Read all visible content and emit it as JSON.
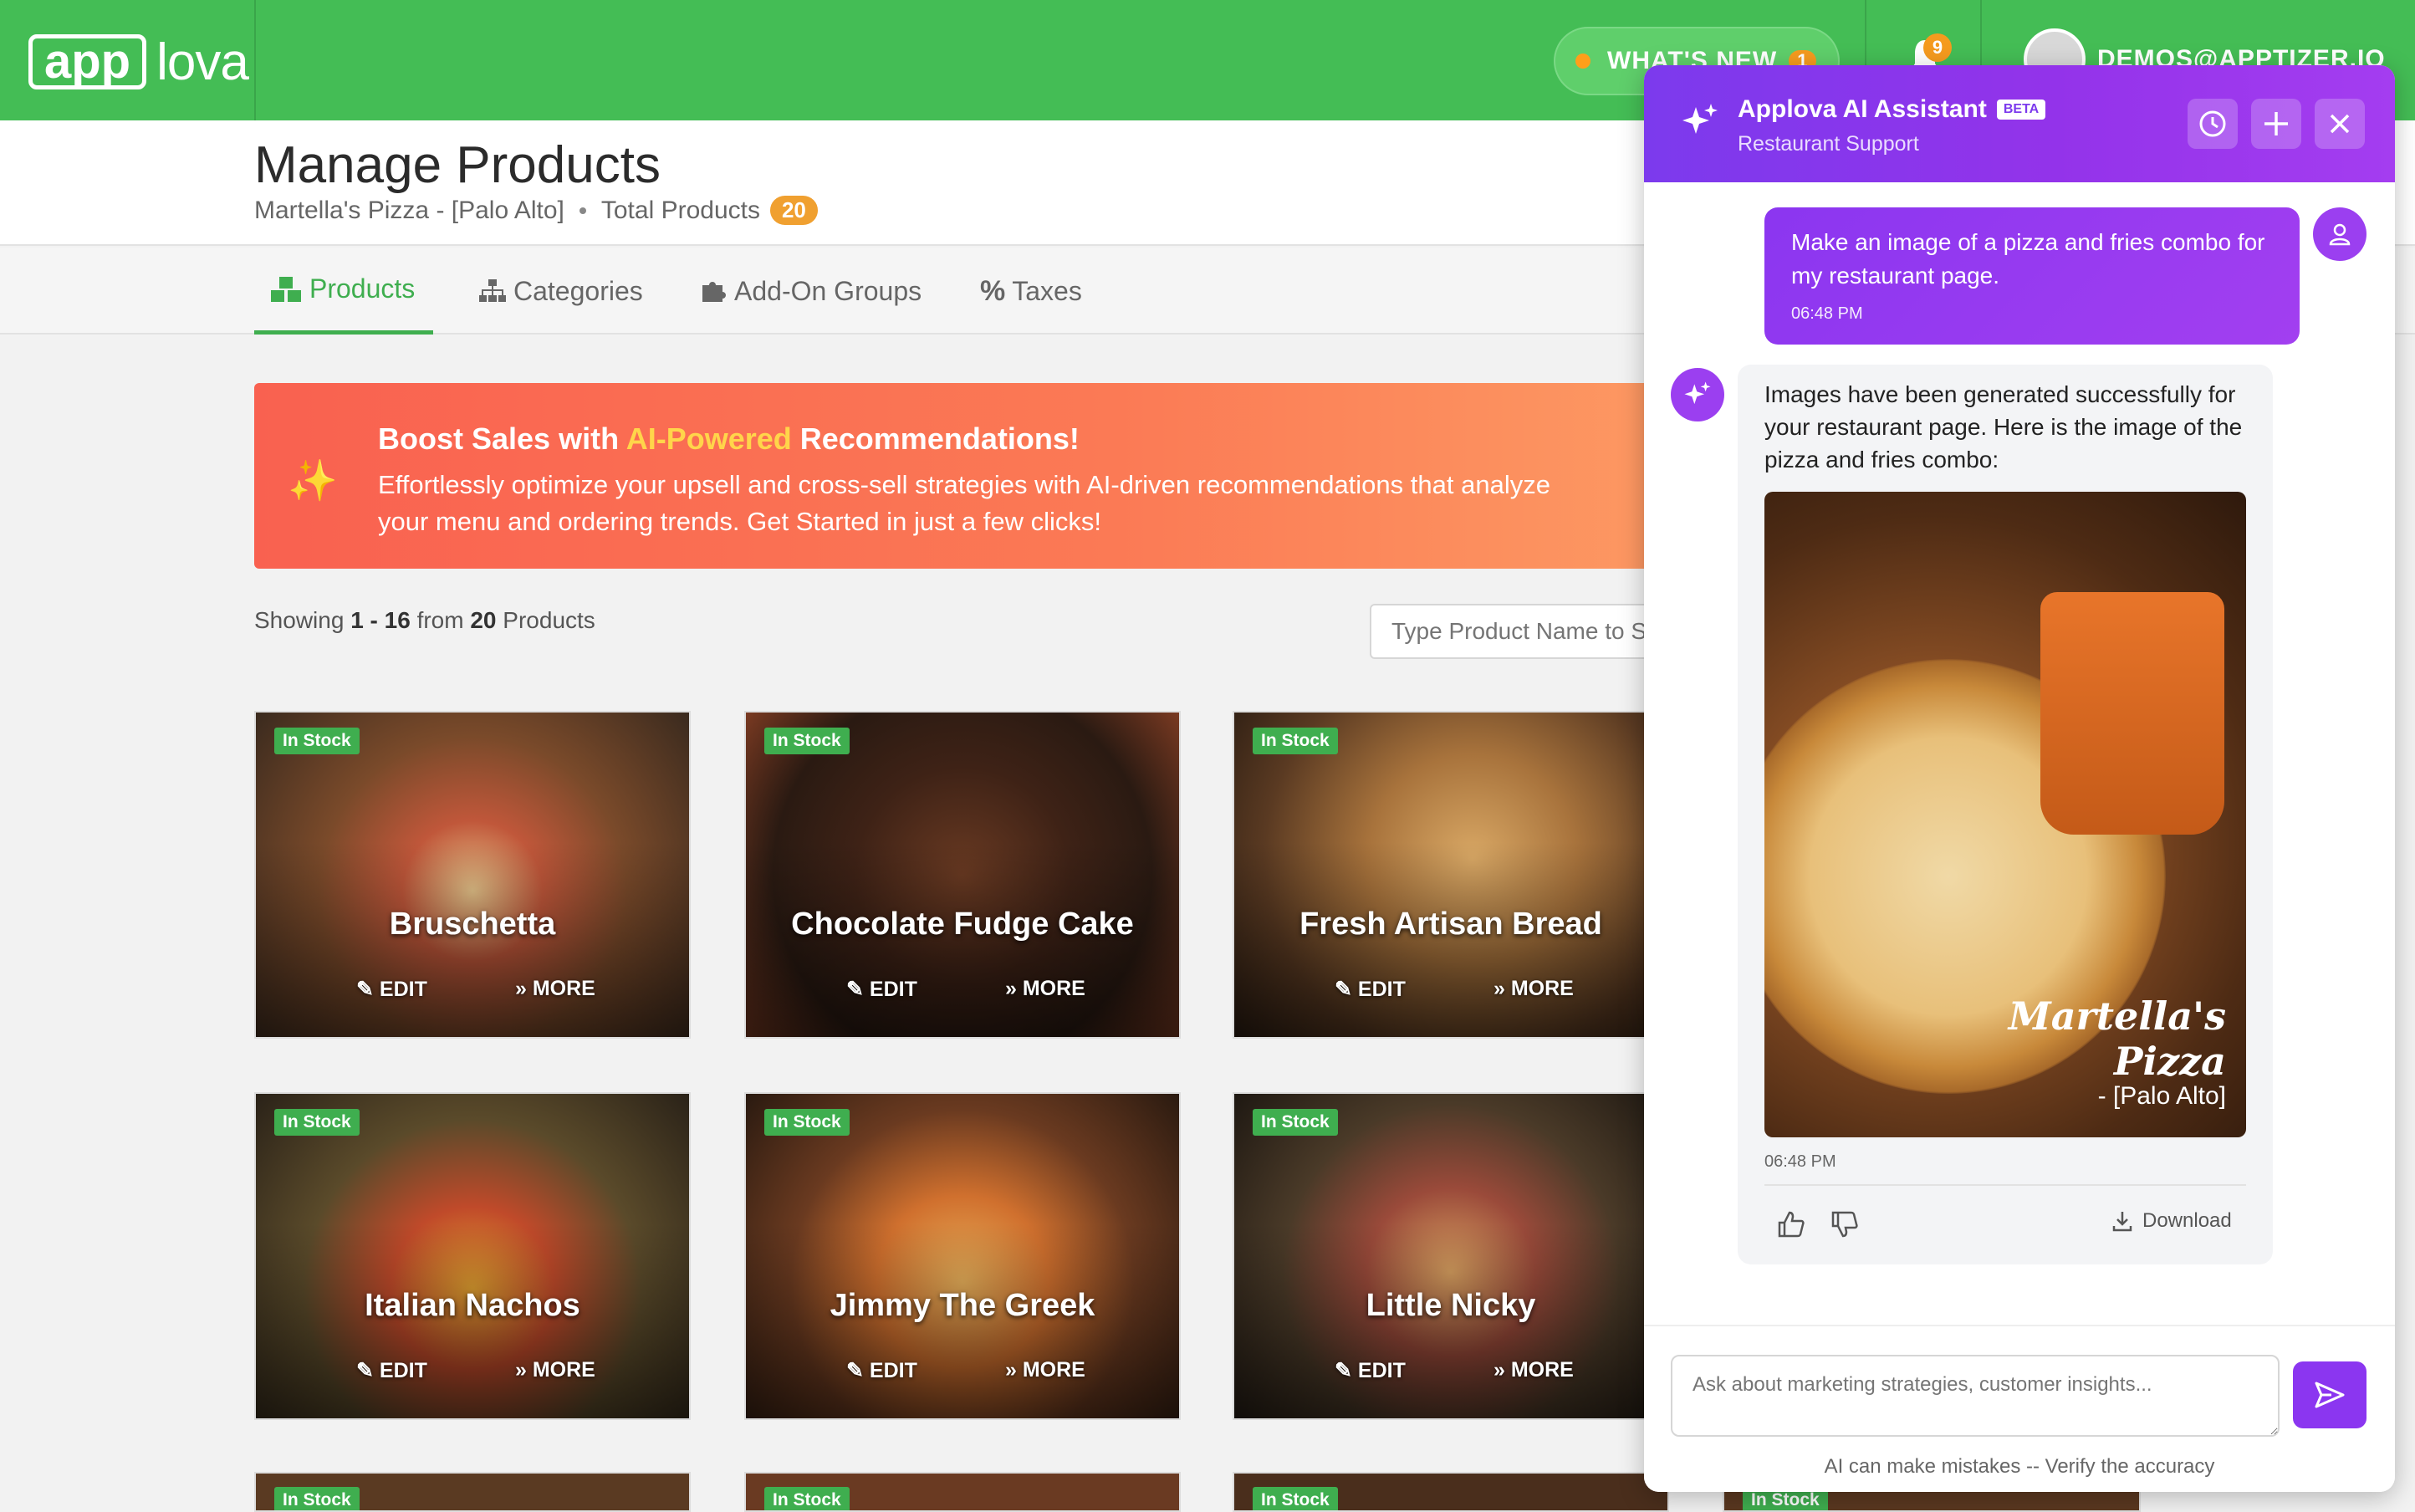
{
  "topbar": {
    "logo_box": "app",
    "logo_rest": "lova",
    "whats_new": "WHAT'S NEW",
    "whats_new_count": "1",
    "notification_count": "9",
    "user_email": "DEMOS@APPTIZER.IO"
  },
  "header": {
    "title": "Manage Products",
    "store": "Martella's Pizza - [Palo Alto]",
    "total_label": "Total Products",
    "total_count": "20"
  },
  "tabs": [
    {
      "label": "Products"
    },
    {
      "label": "Categories"
    },
    {
      "label": "Add-On Groups"
    },
    {
      "label": "Taxes"
    }
  ],
  "promo": {
    "title_pre": "Boost Sales with ",
    "title_hl": "AI-Powered",
    "title_post": " Recommendations!",
    "desc": "Effortlessly optimize your upsell and cross-sell strategies with AI-driven recommendations that analyze your menu and ordering trends. Get Started in just a few clicks!"
  },
  "listing": {
    "showing_pre": "Showing ",
    "range": "1 - 16",
    "from": " from ",
    "total": "20",
    "suffix": " Products",
    "search_placeholder": "Type Product Name to Search"
  },
  "products": [
    {
      "name": "Bruschetta",
      "badge": "In Stock",
      "edit": "EDIT",
      "more": "MORE"
    },
    {
      "name": "Chocolate Fudge Cake",
      "badge": "In Stock",
      "edit": "EDIT",
      "more": "MORE"
    },
    {
      "name": "Fresh Artisan Bread",
      "badge": "In Stock",
      "edit": "EDIT",
      "more": "MORE"
    },
    {
      "name": "Italian Nachos",
      "badge": "In Stock",
      "edit": "EDIT",
      "more": "MORE"
    },
    {
      "name": "Jimmy The Greek",
      "badge": "In Stock",
      "edit": "EDIT",
      "more": "MORE"
    },
    {
      "name": "Little Nicky",
      "badge": "In Stock",
      "edit": "EDIT",
      "more": "MORE"
    },
    {
      "badge": "In Stock"
    },
    {
      "badge": "In Stock"
    },
    {
      "badge": "In Stock"
    },
    {
      "badge": "In Stock"
    }
  ],
  "assistant": {
    "title": "Applova AI Assistant",
    "beta": "BETA",
    "subtitle": "Restaurant Support",
    "user_message": "Make an image of a pizza and fries combo for my restaurant page.",
    "user_time": "06:48 PM",
    "ai_message": "Images have been generated successfully for your restaurant page. Here is the image of the pizza and fries combo:",
    "image_caption_1": "Martella's",
    "image_caption_2": "Pizza",
    "image_caption_3": "- [Palo Alto]",
    "ai_time": "06:48 PM",
    "download": "Download",
    "input_placeholder": "Ask about marketing strategies, customer insights...",
    "disclaimer": "AI can make mistakes -- Verify the accuracy"
  },
  "colors": {
    "brand_green": "#44bd55",
    "assistant_purple": "#8b36f0",
    "promo_orange": "#f96150",
    "accent_amber": "#f0a030"
  }
}
